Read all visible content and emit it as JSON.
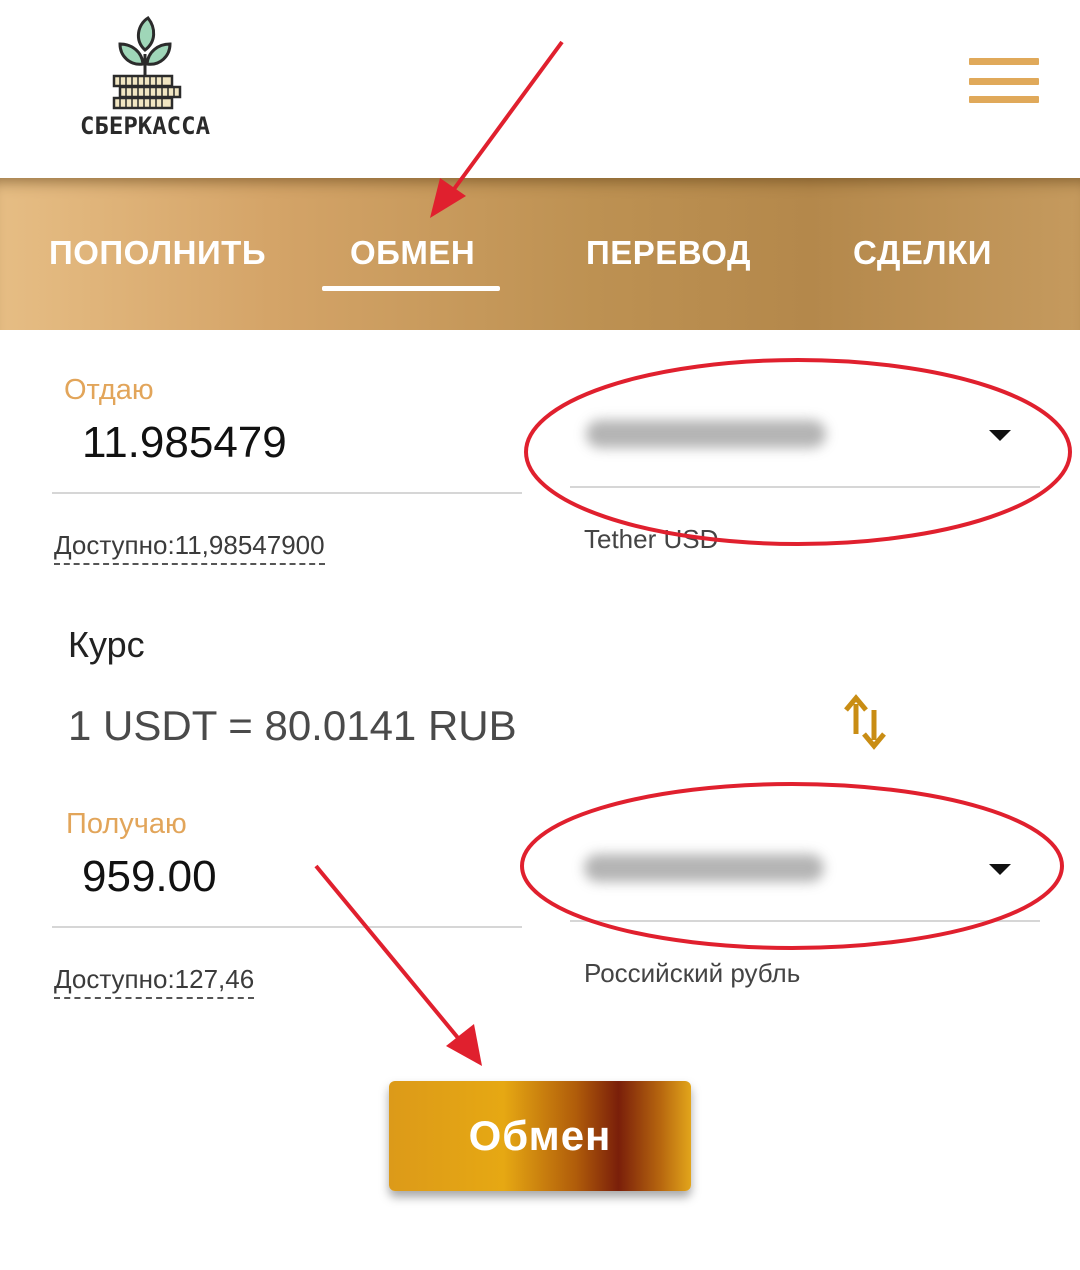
{
  "brand": {
    "name": "СБЕРКАССА"
  },
  "nav": {
    "tabs": [
      {
        "label": "ПОПОЛНИТЬ",
        "active": false
      },
      {
        "label": "ОБМЕН",
        "active": true
      },
      {
        "label": "ПЕРЕВОД",
        "active": false
      },
      {
        "label": "СДЕЛКИ",
        "active": false
      }
    ]
  },
  "give": {
    "label": "Отдаю",
    "amount": "11.985479",
    "available": "Доступно:11,98547900",
    "currency_name": "Tether USD"
  },
  "rate": {
    "title": "Курс",
    "value": "1 USDT = 80.0141 RUB"
  },
  "receive": {
    "label": "Получаю",
    "amount": "959.00",
    "available": "Доступно:127,46",
    "currency_name": "Российский рубль"
  },
  "submit": {
    "label": "Обмен"
  },
  "colors": {
    "accent_orange": "#e2a55a",
    "nav_gold": "#c59a5e",
    "annotation_red": "#e0202e"
  },
  "icons": [
    "sprout-coins-logo",
    "hamburger-menu-icon",
    "swap-arrows-icon",
    "dropdown-caret-icon"
  ]
}
